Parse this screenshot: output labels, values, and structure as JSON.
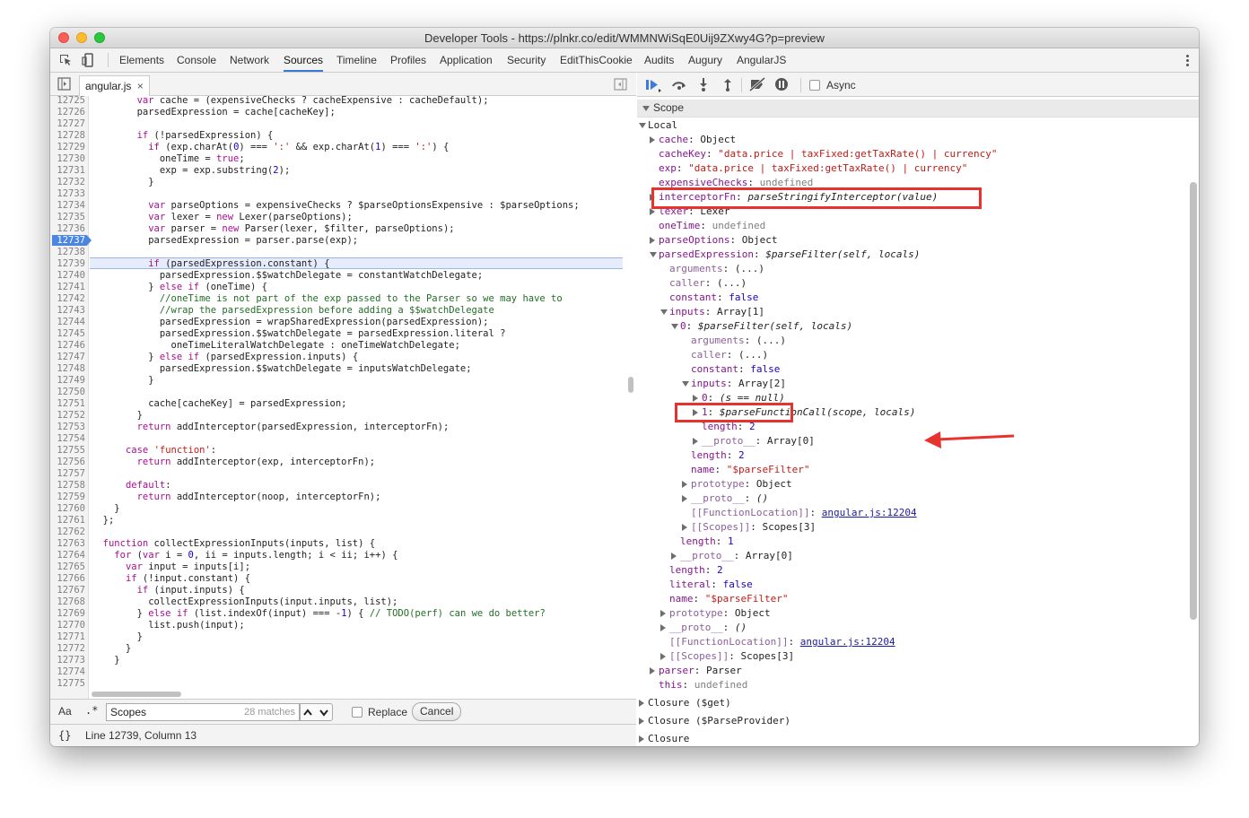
{
  "window": {
    "title": "Developer Tools - https://plnkr.co/edit/WMMNWiSqE0Uij9ZXwy4G?p=preview"
  },
  "tabs": [
    "Elements",
    "Console",
    "Network",
    "Sources",
    "Timeline",
    "Profiles",
    "Application",
    "Security",
    "EditThisCookie",
    "Audits",
    "Augury",
    "AngularJS"
  ],
  "active_tab": "Sources",
  "file_tab": {
    "name": "angular.js",
    "close": "×"
  },
  "editor": {
    "lines": [
      {
        "n": "12725",
        "t": "        var cache = (expensiveChecks ? cacheExpensive : cacheDefault);"
      },
      {
        "n": "12726",
        "t": "        parsedExpression = cache[cacheKey];"
      },
      {
        "n": "12727",
        "t": ""
      },
      {
        "n": "12728",
        "t": "        if (!parsedExpression) {"
      },
      {
        "n": "12729",
        "t": "          if (exp.charAt(0) === ':' && exp.charAt(1) === ':') {"
      },
      {
        "n": "12730",
        "t": "            oneTime = true;"
      },
      {
        "n": "12731",
        "t": "            exp = exp.substring(2);"
      },
      {
        "n": "12732",
        "t": "          }"
      },
      {
        "n": "12733",
        "t": ""
      },
      {
        "n": "12734",
        "t": "          var parseOptions = expensiveChecks ? $parseOptionsExpensive : $parseOptions;"
      },
      {
        "n": "12735",
        "t": "          var lexer = new Lexer(parseOptions);"
      },
      {
        "n": "12736",
        "t": "          var parser = new Parser(lexer, $filter, parseOptions);"
      },
      {
        "n": "12737",
        "t": "          parsedExpression = parser.parse(exp);"
      },
      {
        "n": "12738",
        "t": ""
      },
      {
        "n": "12739",
        "t": "          if (parsedExpression.constant) {"
      },
      {
        "n": "12740",
        "t": "            parsedExpression.$$watchDelegate = constantWatchDelegate;"
      },
      {
        "n": "12741",
        "t": "          } else if (oneTime) {"
      },
      {
        "n": "12742",
        "t": "            //oneTime is not part of the exp passed to the Parser so we may have to"
      },
      {
        "n": "12743",
        "t": "            //wrap the parsedExpression before adding a $$watchDelegate"
      },
      {
        "n": "12744",
        "t": "            parsedExpression = wrapSharedExpression(parsedExpression);"
      },
      {
        "n": "12745",
        "t": "            parsedExpression.$$watchDelegate = parsedExpression.literal ?"
      },
      {
        "n": "12746",
        "t": "              oneTimeLiteralWatchDelegate : oneTimeWatchDelegate;"
      },
      {
        "n": "12747",
        "t": "          } else if (parsedExpression.inputs) {"
      },
      {
        "n": "12748",
        "t": "            parsedExpression.$$watchDelegate = inputsWatchDelegate;"
      },
      {
        "n": "12749",
        "t": "          }"
      },
      {
        "n": "12750",
        "t": ""
      },
      {
        "n": "12751",
        "t": "          cache[cacheKey] = parsedExpression;"
      },
      {
        "n": "12752",
        "t": "        }"
      },
      {
        "n": "12753",
        "t": "        return addInterceptor(parsedExpression, interceptorFn);"
      },
      {
        "n": "12754",
        "t": ""
      },
      {
        "n": "12755",
        "t": "      case 'function':"
      },
      {
        "n": "12756",
        "t": "        return addInterceptor(exp, interceptorFn);"
      },
      {
        "n": "12757",
        "t": ""
      },
      {
        "n": "12758",
        "t": "      default:"
      },
      {
        "n": "12759",
        "t": "        return addInterceptor(noop, interceptorFn);"
      },
      {
        "n": "12760",
        "t": "    }"
      },
      {
        "n": "12761",
        "t": "  };"
      },
      {
        "n": "12762",
        "t": ""
      },
      {
        "n": "12763",
        "t": "  function collectExpressionInputs(inputs, list) {"
      },
      {
        "n": "12764",
        "t": "    for (var i = 0, ii = inputs.length; i < ii; i++) {"
      },
      {
        "n": "12765",
        "t": "      var input = inputs[i];"
      },
      {
        "n": "12766",
        "t": "      if (!input.constant) {"
      },
      {
        "n": "12767",
        "t": "        if (input.inputs) {"
      },
      {
        "n": "12768",
        "t": "          collectExpressionInputs(input.inputs, list);"
      },
      {
        "n": "12769",
        "t": "        } else if (list.indexOf(input) === -1) { // TODO(perf) can we do better?"
      },
      {
        "n": "12770",
        "t": "          list.push(input);"
      },
      {
        "n": "12771",
        "t": "        }"
      },
      {
        "n": "12772",
        "t": "      }"
      },
      {
        "n": "12773",
        "t": "    }"
      },
      {
        "n": "12774",
        "t": ""
      },
      {
        "n": "12775",
        "t": ""
      }
    ],
    "breakpoint_line": "12737",
    "highlight_line": "12739"
  },
  "search": {
    "case_label": "Aa",
    "regex_label": ".*",
    "value": "Scopes",
    "matches": "28 matches",
    "replace_label": "Replace",
    "cancel_label": "Cancel"
  },
  "status": {
    "format_icon": "{}",
    "position": "Line 12739, Column 13"
  },
  "debugger": {
    "async_label": "Async"
  },
  "scope": {
    "header": "Scope",
    "rows": [
      {
        "d": 0,
        "tri": "d",
        "k": "Local"
      },
      {
        "d": 1,
        "tri": "r",
        "k": "cache",
        "v": "Object"
      },
      {
        "d": 1,
        "tri": "",
        "k": "cacheKey",
        "v": "\"data.price | taxFixed:getTaxRate() | currency\"",
        "vt": "str"
      },
      {
        "d": 1,
        "tri": "",
        "k": "exp",
        "v": "\"data.price | taxFixed:getTaxRate() | currency\"",
        "vt": "str"
      },
      {
        "d": 1,
        "tri": "",
        "k": "expensiveChecks",
        "v": "undefined",
        "vt": "undef"
      },
      {
        "d": 1,
        "tri": "r",
        "k": "interceptorFn",
        "v": "parseStringifyInterceptor(value)",
        "vt": "fn"
      },
      {
        "d": 1,
        "tri": "r",
        "k": "lexer",
        "v": "Lexer"
      },
      {
        "d": 1,
        "tri": "",
        "k": "oneTime",
        "v": "undefined",
        "vt": "undef"
      },
      {
        "d": 1,
        "tri": "r",
        "k": "parseOptions",
        "v": "Object"
      },
      {
        "d": 1,
        "tri": "d",
        "k": "parsedExpression",
        "v": "$parseFilter(self, locals)",
        "vt": "fn"
      },
      {
        "d": 2,
        "tri": "",
        "k": "arguments",
        "v": "(...)",
        "kt": "dim"
      },
      {
        "d": 2,
        "tri": "",
        "k": "caller",
        "v": "(...)",
        "kt": "dim"
      },
      {
        "d": 2,
        "tri": "",
        "k": "constant",
        "v": "false",
        "vt": "num"
      },
      {
        "d": 2,
        "tri": "d",
        "k": "inputs",
        "v": "Array[1]"
      },
      {
        "d": 3,
        "tri": "d",
        "k": "0",
        "v": "$parseFilter(self, locals)",
        "vt": "fn"
      },
      {
        "d": 4,
        "tri": "",
        "k": "arguments",
        "v": "(...)",
        "kt": "dim"
      },
      {
        "d": 4,
        "tri": "",
        "k": "caller",
        "v": "(...)",
        "kt": "dim"
      },
      {
        "d": 4,
        "tri": "",
        "k": "constant",
        "v": "false",
        "vt": "num"
      },
      {
        "d": 4,
        "tri": "d",
        "k": "inputs",
        "v": "Array[2]"
      },
      {
        "d": 5,
        "tri": "r",
        "k": "0",
        "v": "(s == null)",
        "vt": "fn"
      },
      {
        "d": 5,
        "tri": "r",
        "k": "1",
        "v": "$parseFunctionCall(scope, locals)",
        "vt": "fn"
      },
      {
        "d": 5,
        "tri": "",
        "k": "length",
        "v": "2",
        "vt": "num"
      },
      {
        "d": 5,
        "tri": "r",
        "k": "__proto__",
        "v": "Array[0]",
        "kt": "dim"
      },
      {
        "d": 4,
        "tri": "",
        "k": "length",
        "v": "2",
        "vt": "num"
      },
      {
        "d": 4,
        "tri": "",
        "k": "name",
        "v": "\"$parseFilter\"",
        "vt": "str"
      },
      {
        "d": 4,
        "tri": "r",
        "k": "prototype",
        "v": "Object",
        "kt": "dim"
      },
      {
        "d": 4,
        "tri": "r",
        "k": "__proto__",
        "v": "()",
        "kt": "dim",
        "vt": "fn"
      },
      {
        "d": 4,
        "tri": "",
        "k": "[[FunctionLocation]]",
        "v": "angular.js:12204",
        "kt": "dim",
        "vt": "link"
      },
      {
        "d": 4,
        "tri": "r",
        "k": "[[Scopes]]",
        "v": "Scopes[3]",
        "kt": "dim"
      },
      {
        "d": 3,
        "tri": "",
        "k": "length",
        "v": "1",
        "vt": "num"
      },
      {
        "d": 3,
        "tri": "r",
        "k": "__proto__",
        "v": "Array[0]",
        "kt": "dim"
      },
      {
        "d": 2,
        "tri": "",
        "k": "length",
        "v": "2",
        "vt": "num"
      },
      {
        "d": 2,
        "tri": "",
        "k": "literal",
        "v": "false",
        "vt": "num"
      },
      {
        "d": 2,
        "tri": "",
        "k": "name",
        "v": "\"$parseFilter\"",
        "vt": "str"
      },
      {
        "d": 2,
        "tri": "r",
        "k": "prototype",
        "v": "Object",
        "kt": "dim"
      },
      {
        "d": 2,
        "tri": "r",
        "k": "__proto__",
        "v": "()",
        "kt": "dim",
        "vt": "fn"
      },
      {
        "d": 2,
        "tri": "",
        "k": "[[FunctionLocation]]",
        "v": "angular.js:12204",
        "kt": "dim",
        "vt": "link"
      },
      {
        "d": 2,
        "tri": "r",
        "k": "[[Scopes]]",
        "v": "Scopes[3]",
        "kt": "dim"
      },
      {
        "d": 1,
        "tri": "r",
        "k": "parser",
        "v": "Parser"
      },
      {
        "d": 1,
        "tri": "",
        "k": "this",
        "v": "undefined",
        "vt": "undef"
      }
    ],
    "closures": [
      "Closure ($get)",
      "Closure ($ParseProvider)",
      "Closure"
    ]
  },
  "colors": {
    "accent": "#3879d9",
    "annotation": "#e8322d",
    "breakpoint": "#4d86e0"
  }
}
